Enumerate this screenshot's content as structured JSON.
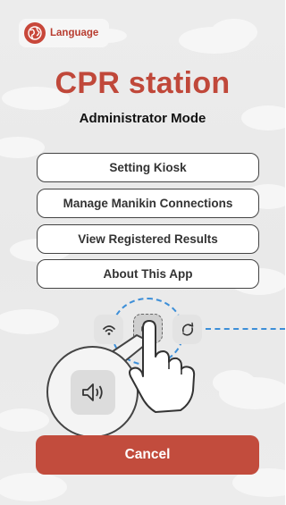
{
  "language_button": {
    "label": "Language",
    "icon": "globe-icon"
  },
  "header": {
    "title": "CPR station",
    "subtitle": "Administrator Mode"
  },
  "menu": [
    {
      "label": "Setting Kiosk"
    },
    {
      "label": "Manage Manikin Connections"
    },
    {
      "label": "View Registered Results"
    },
    {
      "label": "About This App"
    }
  ],
  "hidden_gesture": {
    "icons": [
      "wifi-icon",
      "speaker-icon",
      "refresh-icon"
    ],
    "highlighted_icon": "speaker-icon"
  },
  "cancel": {
    "label": "Cancel"
  },
  "colors": {
    "brand": "#c0483a",
    "cancel_bg": "#c24c3d",
    "accent_dash": "#3d8fd8",
    "background": "#ececec"
  }
}
